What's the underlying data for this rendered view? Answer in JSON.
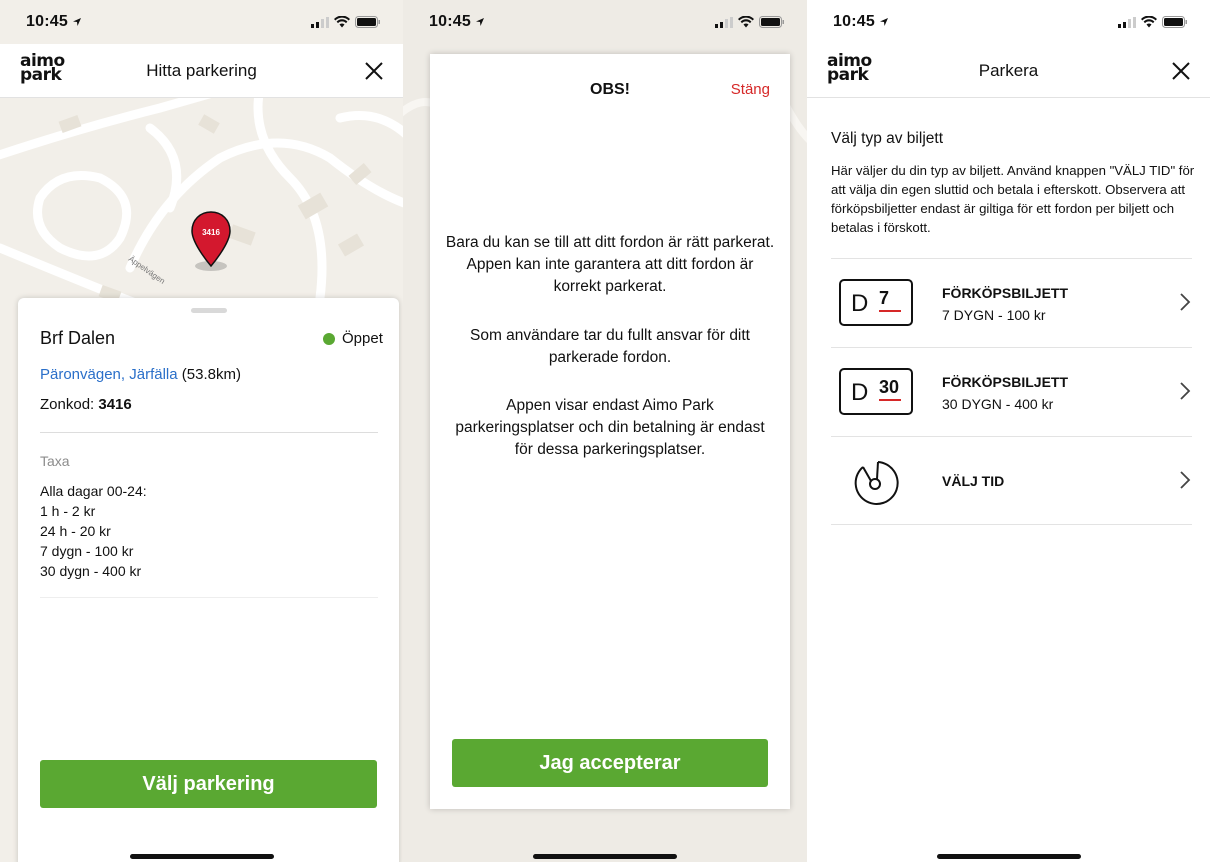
{
  "colors": {
    "green": "#5aa832",
    "red_link": "#d62828",
    "blue_link": "#2a6fc9",
    "pin_red": "#d3182e"
  },
  "screen1": {
    "status_time": "10:45",
    "logo_top": "aimo",
    "logo_bottom": "park",
    "title": "Hitta parkering",
    "map": {
      "pin_label": "3416",
      "street_label": "Äppelvägen"
    },
    "lot": {
      "name": "Brf Dalen",
      "status": "Öppet",
      "address_link": "Päronvägen, Järfälla",
      "distance": "(53.8km)",
      "zone_label": "Zonkod:",
      "zone_value": "3416",
      "taxa_heading": "Taxa",
      "taxa_lines": [
        "Alla dagar 00-24:",
        "1 h - 2 kr",
        "24 h - 20 kr",
        "7 dygn - 100 kr",
        "30 dygn - 400 kr"
      ]
    },
    "button": "Välj parkering"
  },
  "screen2": {
    "status_time": "10:45",
    "title": "OBS!",
    "close": "Stäng",
    "paragraphs": [
      "Bara du kan se till att ditt fordon är rätt parkerat. Appen kan inte garantera att ditt fordon är korrekt parkerat.",
      "Som användare tar du fullt ansvar för ditt parkerade fordon.",
      "Appen visar endast Aimo Park parkeringsplatser och din betalning är endast för dessa parkeringsplatser."
    ],
    "button": "Jag accepterar"
  },
  "screen3": {
    "status_time": "10:45",
    "logo_top": "aimo",
    "logo_bottom": "park",
    "title": "Parkera",
    "intro_title": "Välj typ av biljett",
    "intro_text": "Här väljer du din typ av biljett. Använd knappen \"VÄLJ TID\" för att välja din egen sluttid och betala i efterskott. Observera att förköpsbiljetter endast är giltiga för ett fordon per biljett och betalas i förskott.",
    "options": [
      {
        "icon_letter": "D",
        "icon_number": "7",
        "title": "FÖRKÖPSBILJETT",
        "subtitle": "7 DYGN - 100 kr"
      },
      {
        "icon_letter": "D",
        "icon_number": "30",
        "title": "FÖRKÖPSBILJETT",
        "subtitle": "30 DYGN - 400 kr"
      },
      {
        "title": "VÄLJ TID"
      }
    ]
  }
}
